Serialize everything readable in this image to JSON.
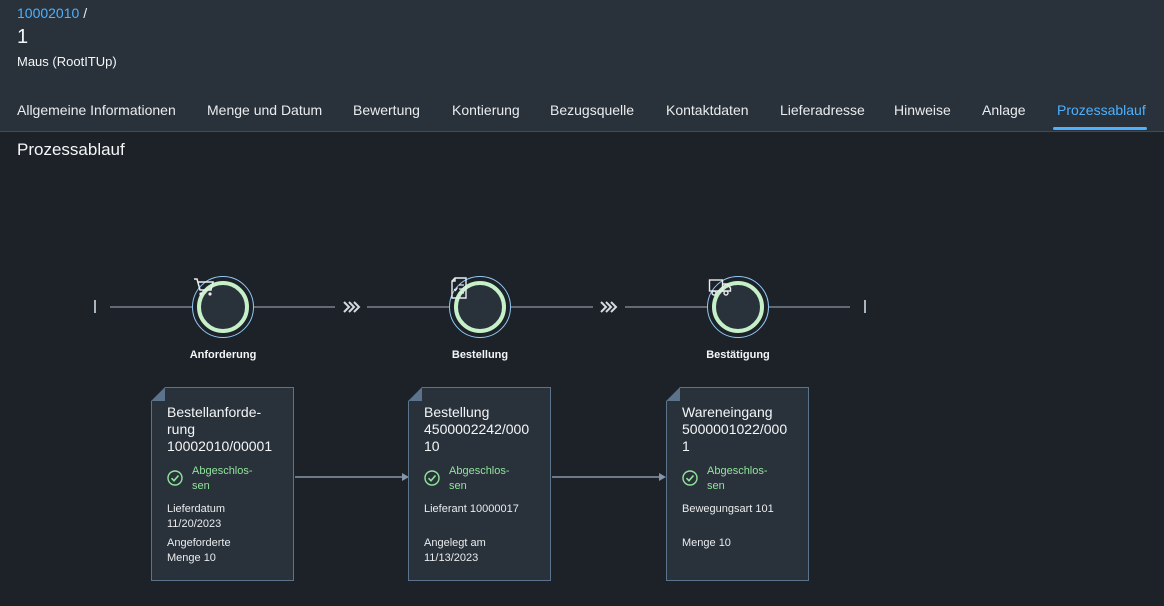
{
  "breadcrumb": {
    "link": "10002010",
    "separator": "/"
  },
  "object": {
    "title": "1",
    "subtitle": "Maus (RootITUp)"
  },
  "tabs": [
    {
      "label": "Allgemeine Informationen",
      "active": false
    },
    {
      "label": "Menge und Datum",
      "active": false
    },
    {
      "label": "Bewertung",
      "active": false
    },
    {
      "label": "Kontierung",
      "active": false
    },
    {
      "label": "Bezugsquelle",
      "active": false
    },
    {
      "label": "Kontaktdaten",
      "active": false
    },
    {
      "label": "Lieferadresse",
      "active": false
    },
    {
      "label": "Hinweise",
      "active": false
    },
    {
      "label": "Anlage",
      "active": false
    },
    {
      "label": "Prozessablauf",
      "active": true
    }
  ],
  "section": {
    "title": "Prozessablauf"
  },
  "lanes": [
    {
      "label": "Anforderung",
      "icon": "cart-icon"
    },
    {
      "label": "Bestellung",
      "icon": "document-list-icon"
    },
    {
      "label": "Bestätigung",
      "icon": "truck-icon"
    }
  ],
  "cards": [
    {
      "title": "Bestellanforde-\nrung\n10002010/00001",
      "status": "Abgeschlos-\nsen",
      "line1": "Lieferdatum\n11/20/2023",
      "line2": "Angeforderte\nMenge 10"
    },
    {
      "title": "Bestellung\n4500002242/000\n10",
      "status": "Abgeschlos-\nsen",
      "line1": "Lieferant 10000017",
      "line2": "Angelegt am\n11/13/2023"
    },
    {
      "title": "Wareneingang\n5000001022/000\n1",
      "status": "Abgeschlos-\nsen",
      "line1": "Bewegungsart 101",
      "line2": "Menge 10"
    }
  ],
  "colors": {
    "accent": "#4db1ff",
    "success": "#91e59c",
    "background": "#1c2228",
    "header": "#29313a"
  }
}
